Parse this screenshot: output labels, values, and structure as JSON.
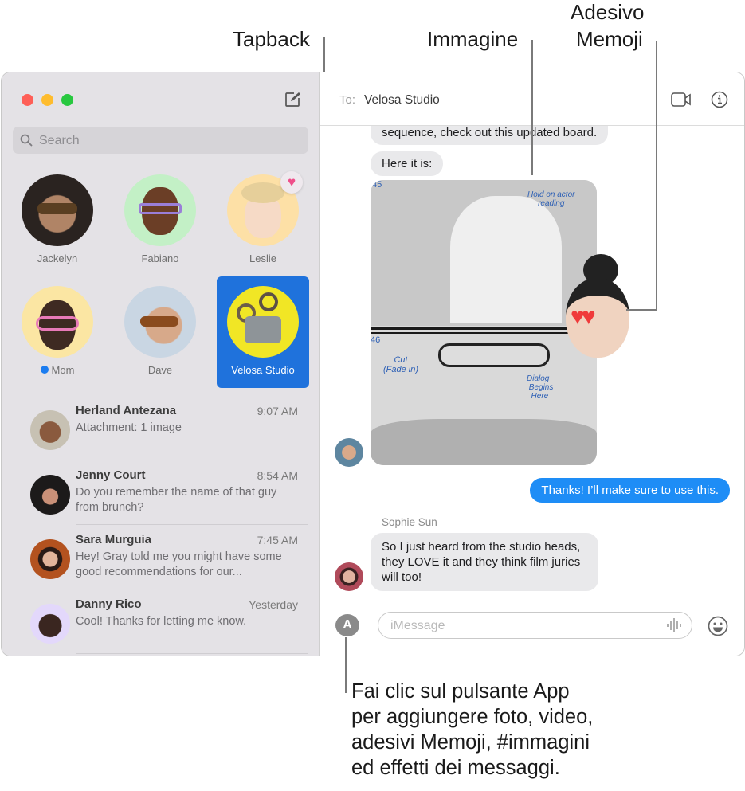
{
  "callouts": {
    "tapback": "Tapback",
    "image": "Immagine",
    "memoji_line1": "Adesivo",
    "memoji_line2": "Memoji",
    "app_button": [
      "Fai clic sul pulsante App",
      "per aggiungere foto, video,",
      "adesivi Memoji, #immagini",
      "ed effetti dei messaggi."
    ]
  },
  "window": {
    "traffic_colors": {
      "close": "#fe5f57",
      "minimize": "#febc2e",
      "zoom": "#28c840"
    },
    "accent": "#1f72dc"
  },
  "sidebar": {
    "search_placeholder": "Search",
    "pinned": [
      {
        "name": "Jackelyn",
        "avatar_bg": "#3a3330"
      },
      {
        "name": "Fabiano",
        "avatar_bg": "#c3f0c6"
      },
      {
        "name": "Leslie",
        "avatar_bg": "#fde0a6",
        "tapback": "heart"
      },
      {
        "name": "Mom",
        "avatar_bg": "#fbe6a3",
        "unread": true
      },
      {
        "name": "Dave",
        "avatar_bg": "#c9d6e3"
      },
      {
        "name": "Velosa Studio",
        "avatar_bg": "#f1e625",
        "selected": true
      }
    ],
    "conversations": [
      {
        "name": "Herland Antezana",
        "time": "9:07 AM",
        "preview": "Attachment: 1 image"
      },
      {
        "name": "Jenny Court",
        "time": "8:54 AM",
        "preview": "Do you remember the name of that guy from brunch?"
      },
      {
        "name": "Sara Murguia",
        "time": "7:45 AM",
        "preview": "Hey! Gray told me you might have some good recommendations for our..."
      },
      {
        "name": "Danny Rico",
        "time": "Yesterday",
        "preview": "Cool! Thanks for letting me know."
      }
    ]
  },
  "chat": {
    "to_label": "To:",
    "recipient": "Velosa Studio",
    "messages": [
      {
        "text": "sequence, check out this updated board.",
        "from": "them"
      },
      {
        "text": "Here it is:",
        "from": "them"
      },
      {
        "type": "image",
        "annotations": [
          "Hold on actor reading",
          "Cut (Fade in)",
          "Dialog Begins Here",
          "45",
          "46"
        ],
        "from": "them",
        "sticker": "memoji-heart-eyes"
      },
      {
        "text": "Thanks! I’ll make sure to use this.",
        "from": "me"
      },
      {
        "sender": "Sophie Sun",
        "text": "So I just heard from the studio heads, they LOVE it and they think film juries will too!",
        "from": "them"
      }
    ],
    "input_placeholder": "iMessage"
  }
}
